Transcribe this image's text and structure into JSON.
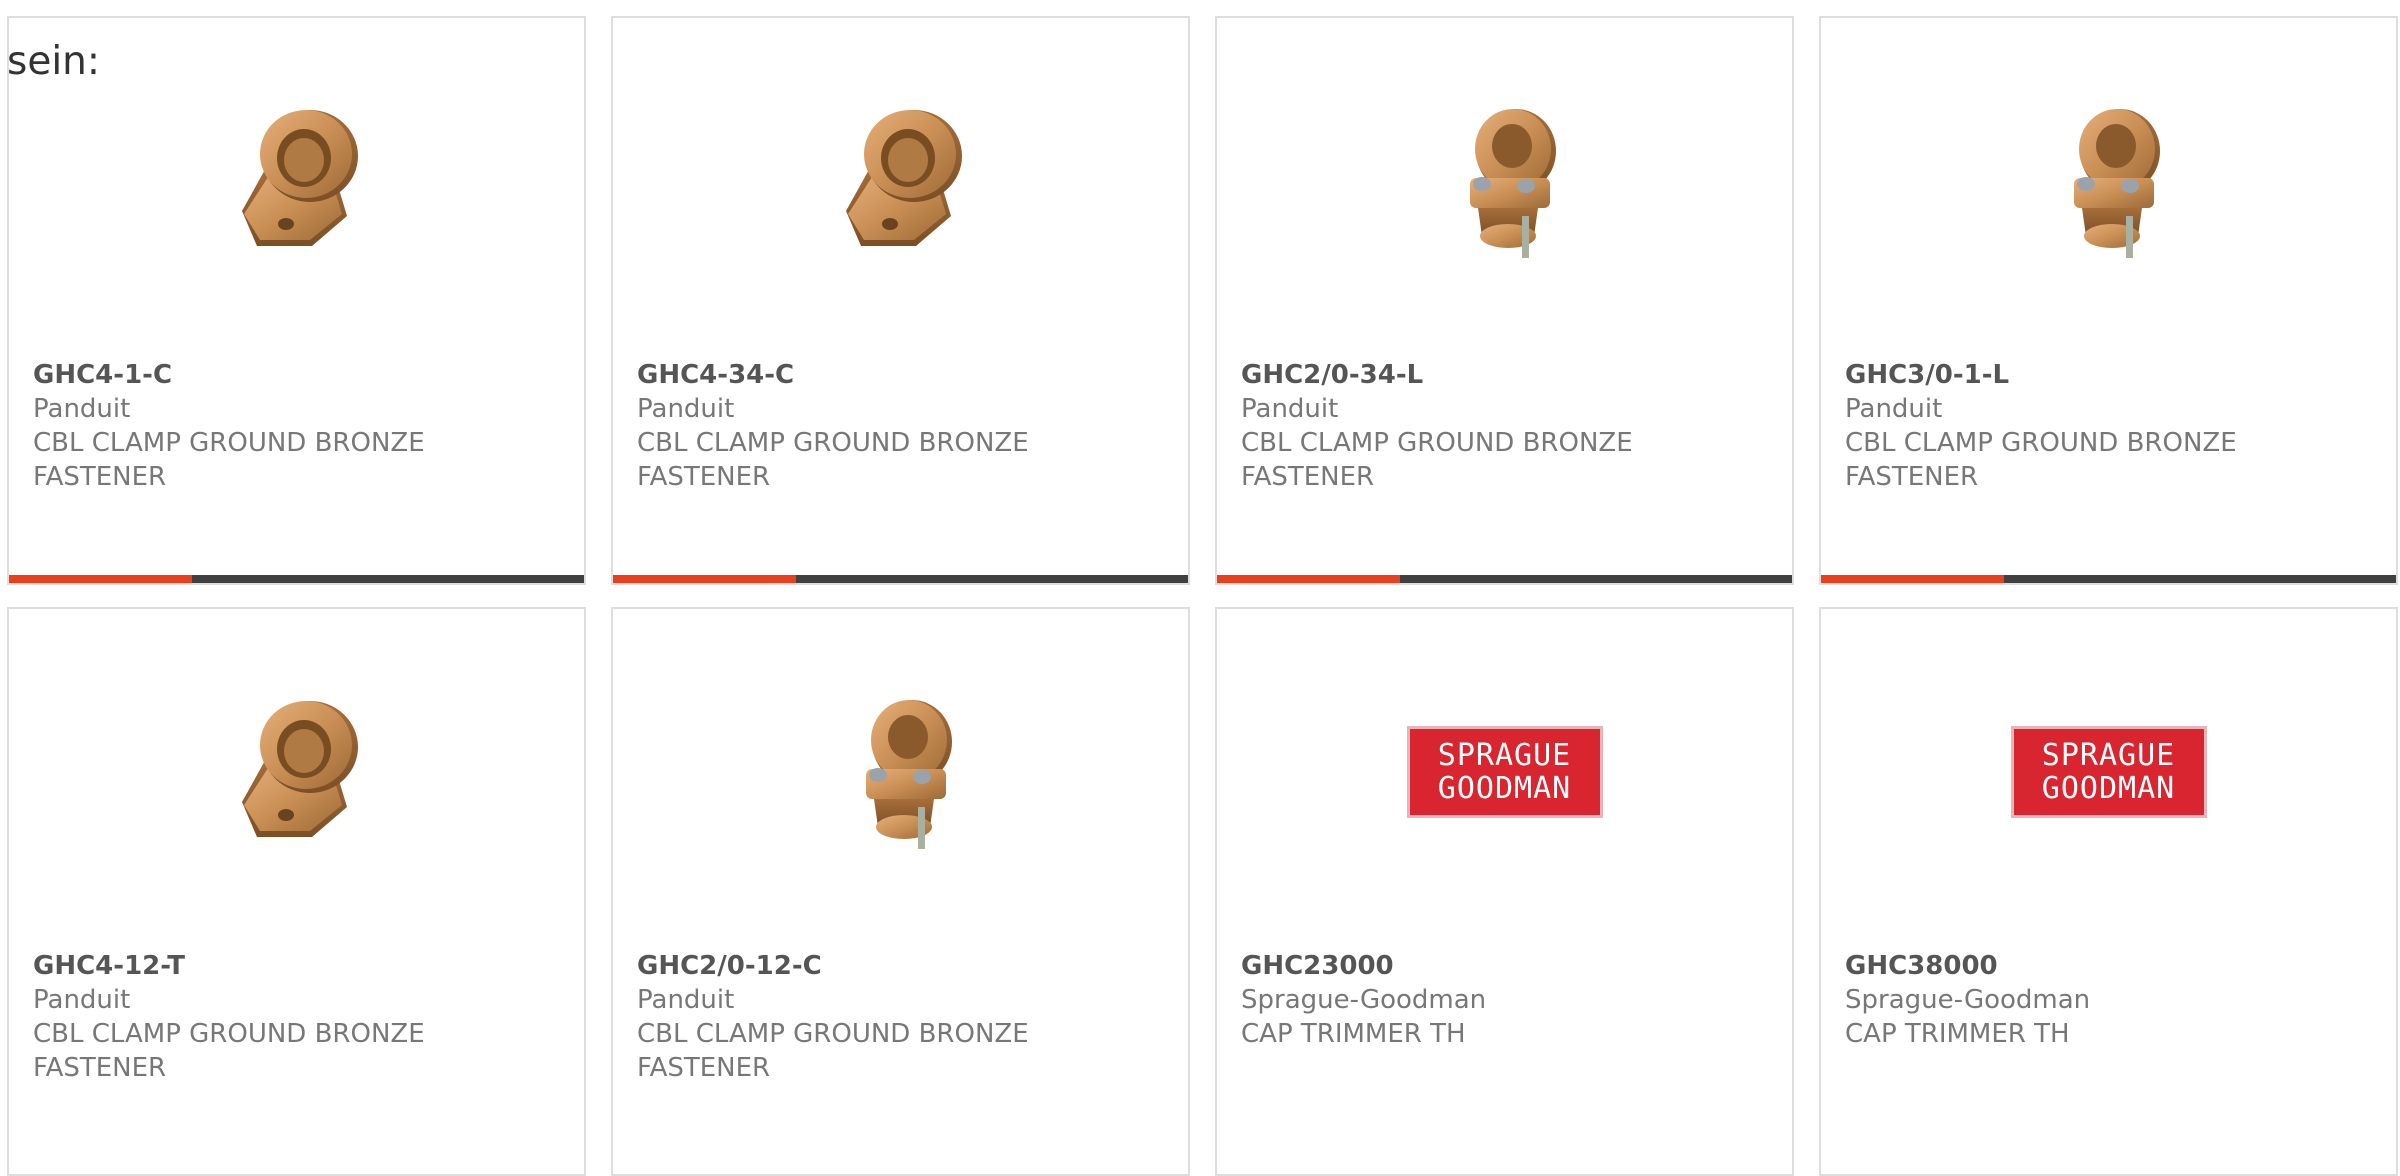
{
  "page_label": "sein:",
  "colors": {
    "accent": "#e8401c",
    "bar": "#404040",
    "border": "#dedede",
    "logo_red": "#d9252f"
  },
  "products": [
    {
      "part_number": "GHC4-1-C",
      "manufacturer": "Panduit",
      "description_line1": "CBL CLAMP GROUND BRONZE",
      "description_line2": "FASTENER",
      "image": "bronze-ground-clamp-lug-icon"
    },
    {
      "part_number": "GHC4-34-C",
      "manufacturer": "Panduit",
      "description_line1": "CBL CLAMP GROUND BRONZE",
      "description_line2": "FASTENER",
      "image": "bronze-ground-clamp-lug-icon"
    },
    {
      "part_number": "GHC2/0-34-L",
      "manufacturer": "Panduit",
      "description_line1": "CBL CLAMP GROUND BRONZE",
      "description_line2": "FASTENER",
      "image": "bronze-ground-clamp-screw-icon"
    },
    {
      "part_number": "GHC3/0-1-L",
      "manufacturer": "Panduit",
      "description_line1": "CBL CLAMP GROUND BRONZE",
      "description_line2": "FASTENER",
      "image": "bronze-ground-clamp-screw-icon"
    },
    {
      "part_number": "GHC4-12-T",
      "manufacturer": "Panduit",
      "description_line1": "CBL CLAMP GROUND BRONZE",
      "description_line2": "FASTENER",
      "image": "bronze-ground-clamp-lug-icon"
    },
    {
      "part_number": "GHC2/0-12-C",
      "manufacturer": "Panduit",
      "description_line1": "CBL CLAMP GROUND BRONZE",
      "description_line2": "FASTENER",
      "image": "bronze-ground-clamp-screw-icon"
    },
    {
      "part_number": "GHC23000",
      "manufacturer": "Sprague-Goodman",
      "description_line1": "CAP TRIMMER TH",
      "logo_line1": "SPRAGUE",
      "logo_line2": "GOODMAN",
      "image": "sprague-goodman-logo"
    },
    {
      "part_number": "GHC38000",
      "manufacturer": "Sprague-Goodman",
      "description_line1": "CAP TRIMMER TH",
      "logo_line1": "SPRAGUE",
      "logo_line2": "GOODMAN",
      "image": "sprague-goodman-logo"
    }
  ]
}
